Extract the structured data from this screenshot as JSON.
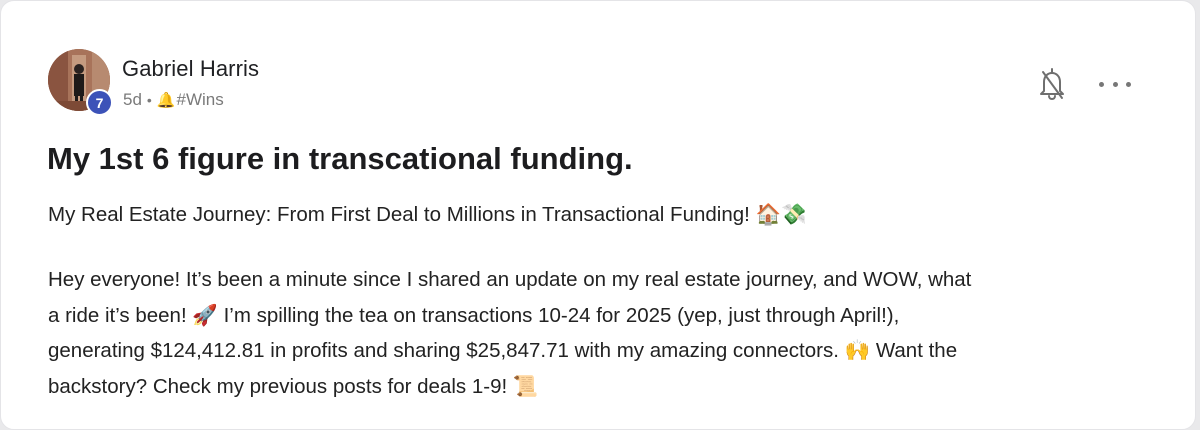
{
  "post": {
    "author": {
      "name": "Gabriel Harris",
      "level": "7"
    },
    "meta": {
      "time": "5d",
      "separator": "•",
      "category_emoji": "🔔",
      "category": "#Wins"
    },
    "title": "My 1st 6 figure in transcational funding.",
    "subtitle": "My Real Estate Journey: From First Deal to Millions in Transactional Funding! 🏠💸",
    "body_lines": [
      "Hey everyone! It’s been a minute since I shared an update on my real estate journey, and WOW, what",
      "a ride it’s been! 🚀 I’m spilling the tea on transactions 10-24 for 2025 (yep, just through April!),",
      "generating $124,412.81 in profits and sharing $25,847.71 with my amazing connectors. 🙌 Want the",
      "backstory? Check my previous posts for deals 1-9! 📜"
    ]
  },
  "icons": {
    "bell": "bell-off-icon",
    "more": "more-horizontal-icon"
  },
  "colors": {
    "level_badge": "#3c52b8",
    "meta_text": "#7a7a7a",
    "title_text": "#1d1d1f"
  }
}
